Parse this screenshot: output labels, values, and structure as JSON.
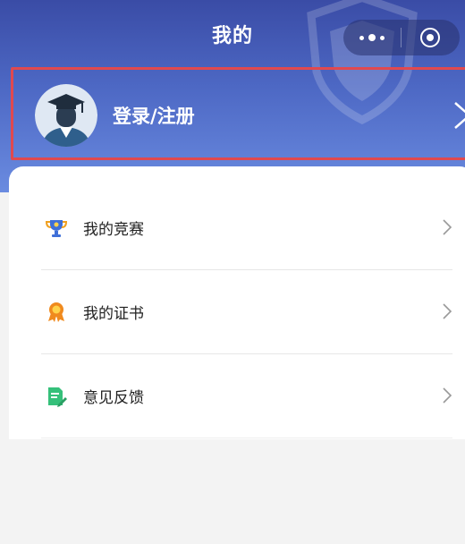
{
  "nav": {
    "title": "我的"
  },
  "capsule": {
    "more_icon": "more-dots-icon",
    "close_icon": "target-icon"
  },
  "profile": {
    "avatar_icon": "graduate-avatar-icon",
    "login_label": "登录/注册",
    "highlight_color": "#e0494f"
  },
  "menu": {
    "items": [
      {
        "label": "我的竞赛",
        "icon": "trophy-icon",
        "icon_color": "#3f6fd8"
      },
      {
        "label": "我的证书",
        "icon": "award-medal-icon",
        "icon_color": "#f08a1e"
      },
      {
        "label": "意见反馈",
        "icon": "feedback-edit-icon",
        "icon_color": "#35c07a"
      }
    ]
  },
  "colors": {
    "header_top": "#3a4ca6",
    "header_bottom": "#6a8be0",
    "page_background": "#f3f3f3"
  }
}
